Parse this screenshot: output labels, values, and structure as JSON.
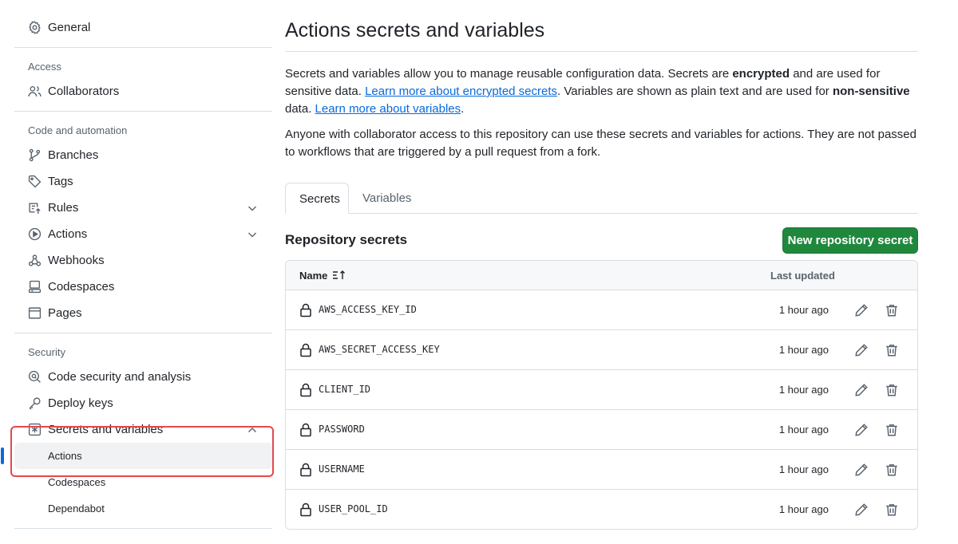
{
  "sidebar": {
    "general": "General",
    "access_title": "Access",
    "collaborators": "Collaborators",
    "code_title": "Code and automation",
    "branches": "Branches",
    "tags": "Tags",
    "rules": "Rules",
    "actions": "Actions",
    "webhooks": "Webhooks",
    "codespaces": "Codespaces",
    "pages": "Pages",
    "security_title": "Security",
    "code_security": "Code security and analysis",
    "deploy_keys": "Deploy keys",
    "secrets_vars": "Secrets and variables",
    "sub_actions": "Actions",
    "sub_codespaces": "Codespaces",
    "sub_dependabot": "Dependabot"
  },
  "main": {
    "title": "Actions secrets and variables",
    "p1_a": "Secrets and variables allow you to manage reusable configuration data. Secrets are ",
    "p1_b": "encrypted",
    "p1_c": " and are used for sensitive data. ",
    "link1": "Learn more about encrypted secrets",
    "p1_d": ". Variables are shown as plain text and are used for ",
    "p1_e": "non-sensitive",
    "p1_f": " data. ",
    "link2": "Learn more about variables",
    "p1_g": ".",
    "p2": "Anyone with collaborator access to this repository can use these secrets and variables for actions. They are not passed to workflows that are triggered by a pull request from a fork.",
    "tabs": [
      {
        "label": "Secrets"
      },
      {
        "label": "Variables"
      }
    ],
    "section_title": "Repository secrets",
    "new_button": "New repository secret",
    "table": {
      "col_name": "Name",
      "col_updated": "Last updated",
      "rows": [
        {
          "name": "AWS_ACCESS_KEY_ID",
          "updated": "1 hour ago"
        },
        {
          "name": "AWS_SECRET_ACCESS_KEY",
          "updated": "1 hour ago"
        },
        {
          "name": "CLIENT_ID",
          "updated": "1 hour ago"
        },
        {
          "name": "PASSWORD",
          "updated": "1 hour ago"
        },
        {
          "name": "USERNAME",
          "updated": "1 hour ago"
        },
        {
          "name": "USER_POOL_ID",
          "updated": "1 hour ago"
        }
      ]
    }
  },
  "colors": {
    "accent": "#0969da",
    "primary_button": "#1f883d",
    "highlight": "#e5484d"
  },
  "icons": {
    "general": "gear-icon",
    "collaborators": "people-icon",
    "branches": "git-branch-icon",
    "tags": "tag-icon",
    "rules": "rules-icon",
    "actions": "play-icon",
    "webhooks": "webhook-icon",
    "codespaces": "codespaces-icon",
    "pages": "browser-icon",
    "code_security": "shield-search-icon",
    "deploy_keys": "key-icon",
    "secrets": "asterisk-icon",
    "lock": "lock-icon",
    "edit": "pencil-icon",
    "delete": "trash-icon",
    "sort": "sort-asc-icon"
  }
}
